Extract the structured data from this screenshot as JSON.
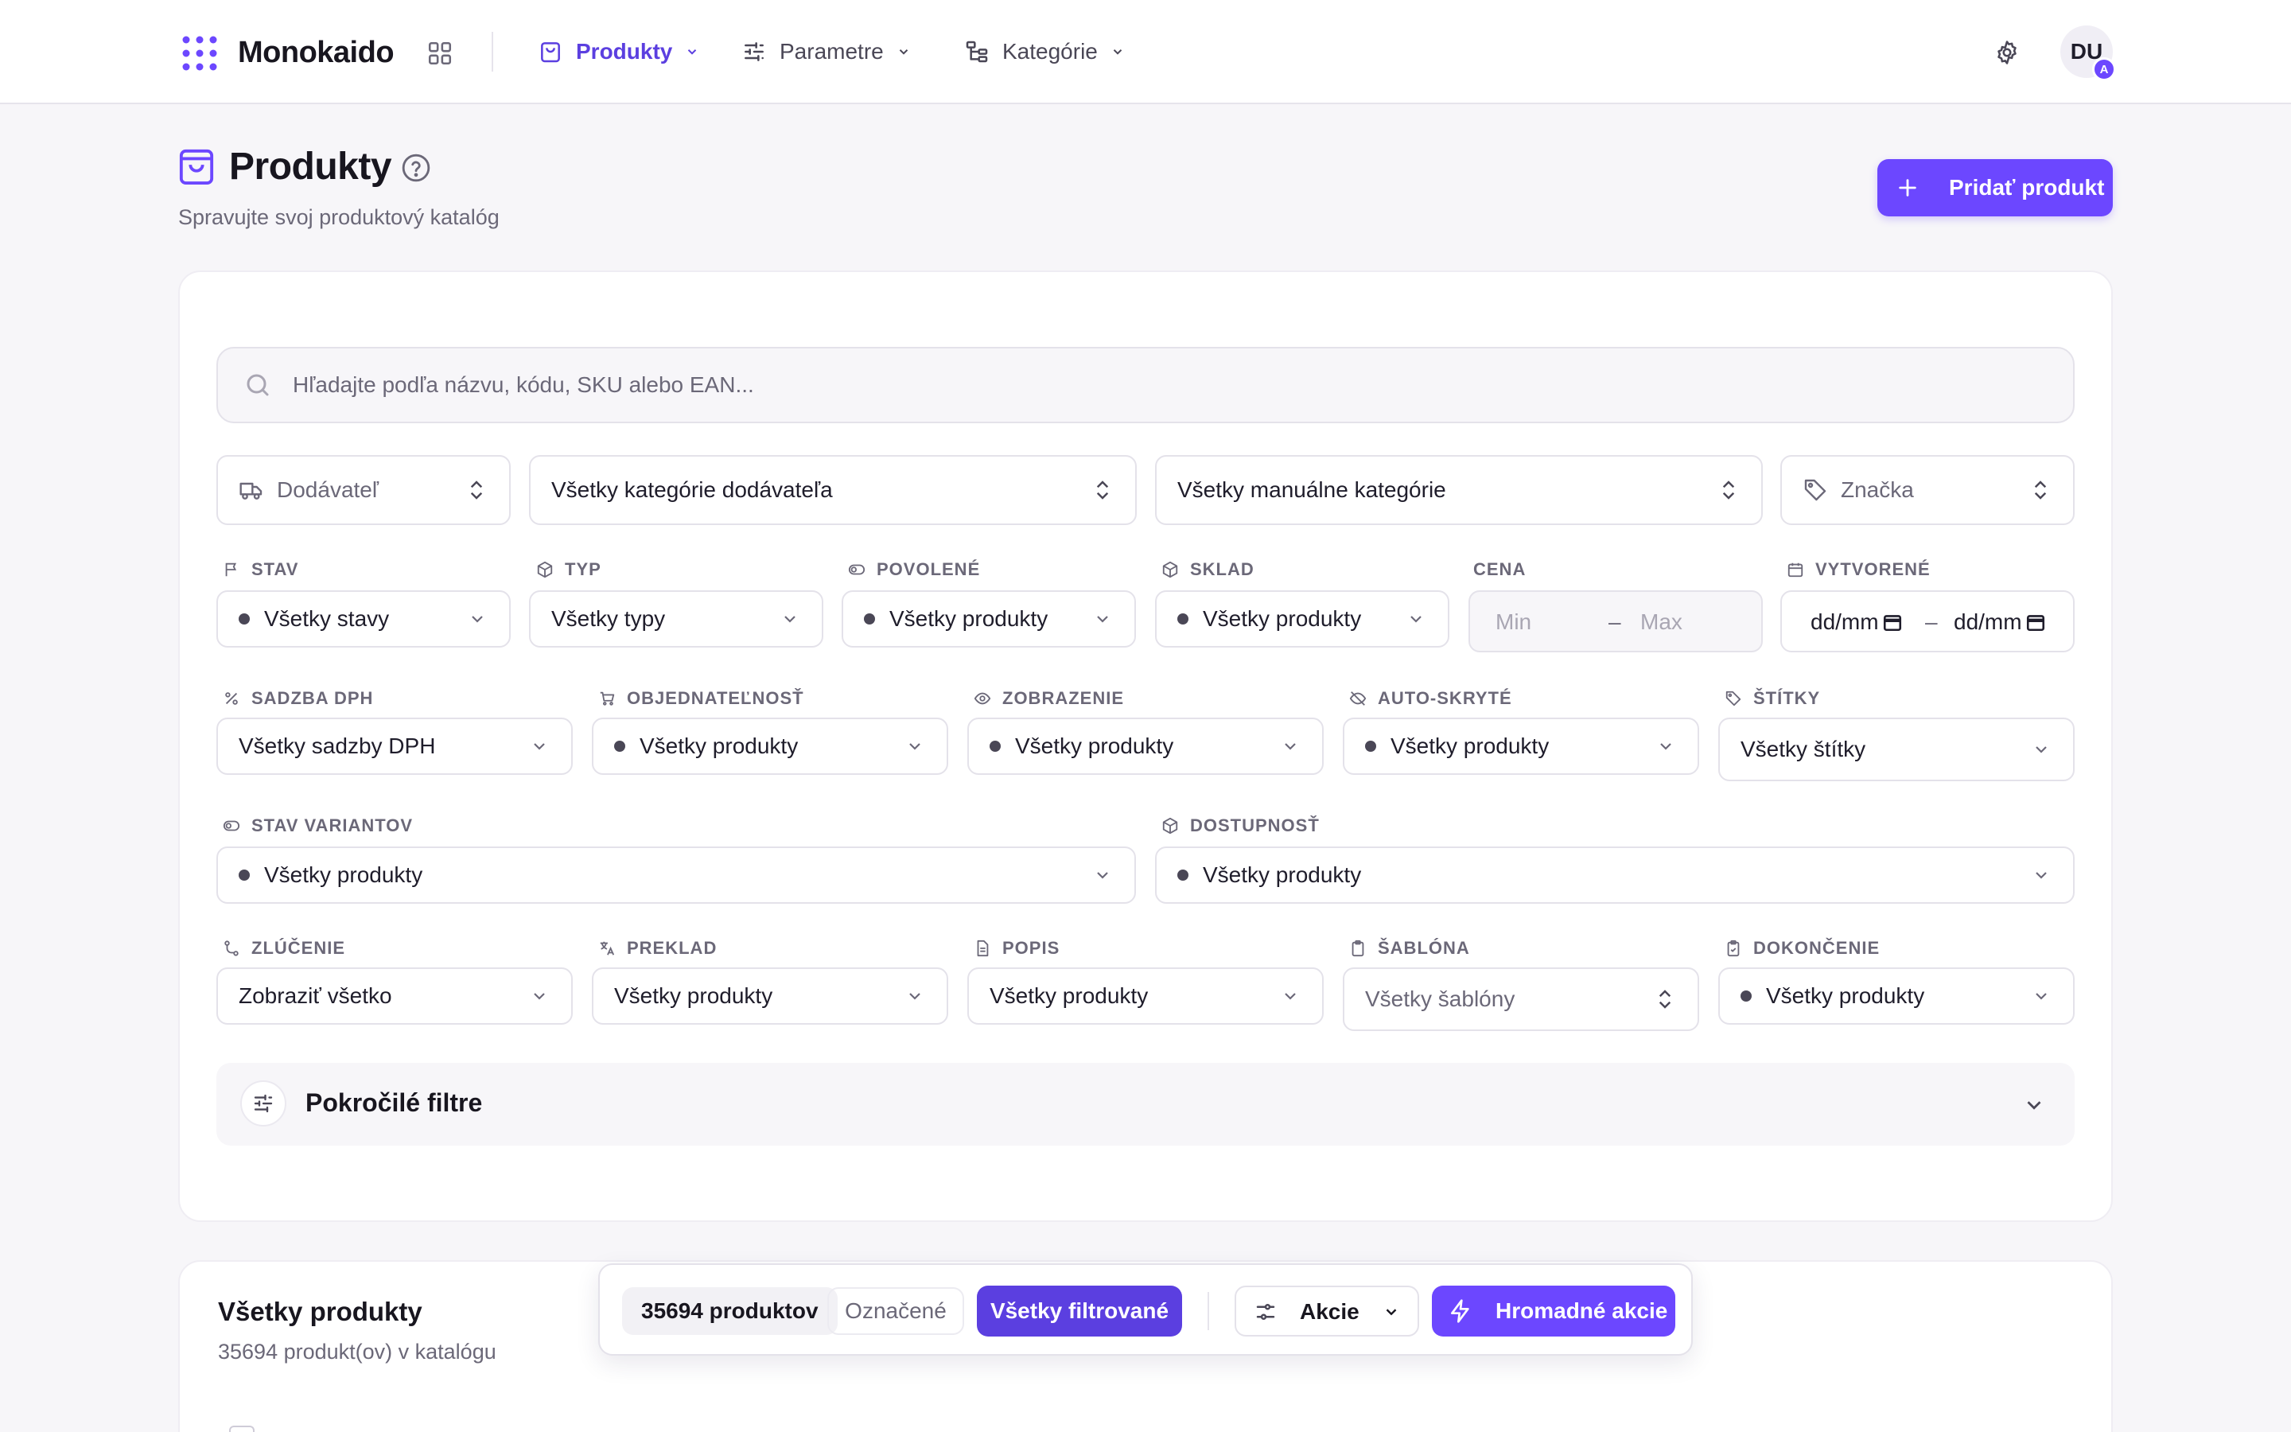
{
  "app": {
    "name": "Monokaido",
    "avatar_initials": "DU",
    "avatar_badge": "A"
  },
  "nav": [
    {
      "label": "Produkty",
      "icon": "shopping-bag-icon",
      "active": true
    },
    {
      "label": "Parametre",
      "icon": "sliders-icon",
      "active": false
    },
    {
      "label": "Kategórie",
      "icon": "hierarchy-icon",
      "active": false
    }
  ],
  "page": {
    "title": "Produkty",
    "subtitle": "Spravujte svoj produktový katalóg",
    "add_button": "Pridať produkt"
  },
  "search": {
    "placeholder": "Hľadajte podľa názvu, kódu, SKU alebo EAN..."
  },
  "top_selects": {
    "supplier": "Dodávateľ",
    "supplier_categories": "Všetky kategórie dodávateľa",
    "manual_categories": "Všetky manuálne kategórie",
    "brand": "Značka"
  },
  "filters_row1": {
    "stav": {
      "label": "STAV",
      "value": "Všetky stavy"
    },
    "typ": {
      "label": "TYP",
      "value": "Všetky typy"
    },
    "povolene": {
      "label": "POVOLENÉ",
      "value": "Všetky produkty"
    },
    "sklad": {
      "label": "SKLAD",
      "value": "Všetky produkty"
    },
    "cena": {
      "label": "CENA",
      "min_placeholder": "Min",
      "separator": "–",
      "max_placeholder": "Max"
    },
    "vytvorene": {
      "label": "VYTVORENÉ",
      "from": "dd/mm",
      "separator": "–",
      "to": "dd/mm"
    }
  },
  "filters_row2": {
    "dph": {
      "label": "SADZBA DPH",
      "value": "Všetky sadzby DPH"
    },
    "objednatelnost": {
      "label": "OBJEDNATEĽNOSŤ",
      "value": "Všetky produkty"
    },
    "zobrazenie": {
      "label": "ZOBRAZENIE",
      "value": "Všetky produkty"
    },
    "auto_skryte": {
      "label": "AUTO-SKRYTÉ",
      "value": "Všetky produkty"
    },
    "stitky": {
      "label": "ŠTÍTKY",
      "value": "Všetky štítky"
    }
  },
  "filters_row3": {
    "stav_variantov": {
      "label": "STAV VARIANTOV",
      "value": "Všetky produkty"
    },
    "dostupnost": {
      "label": "DOSTUPNOSŤ",
      "value": "Všetky produkty"
    }
  },
  "filters_row4": {
    "zlucenie": {
      "label": "ZLÚČENIE",
      "value": "Zobraziť všetko"
    },
    "preklad": {
      "label": "PREKLAD",
      "value": "Všetky produkty"
    },
    "popis": {
      "label": "POPIS",
      "value": "Všetky produkty"
    },
    "sablona": {
      "label": "ŠABLÓNA",
      "value": "Všetky šablóny"
    },
    "dokoncenie": {
      "label": "DOKONČENIE",
      "value": "Všetky produkty"
    }
  },
  "advanced": {
    "label": "Pokročilé filtre"
  },
  "products": {
    "title": "Všetky produkty",
    "subtitle": "35694 produkt(ov) v katalógu"
  },
  "bulk": {
    "count": "35694 produktov",
    "marked": "Označené",
    "all_filtered": "Všetky filtrované",
    "actions": "Akcie",
    "bulk_actions": "Hromadné akcie"
  },
  "colors": {
    "accent": "#6c47ff",
    "accent_dark": "#5b3fe0",
    "background": "#f7f6f9"
  }
}
